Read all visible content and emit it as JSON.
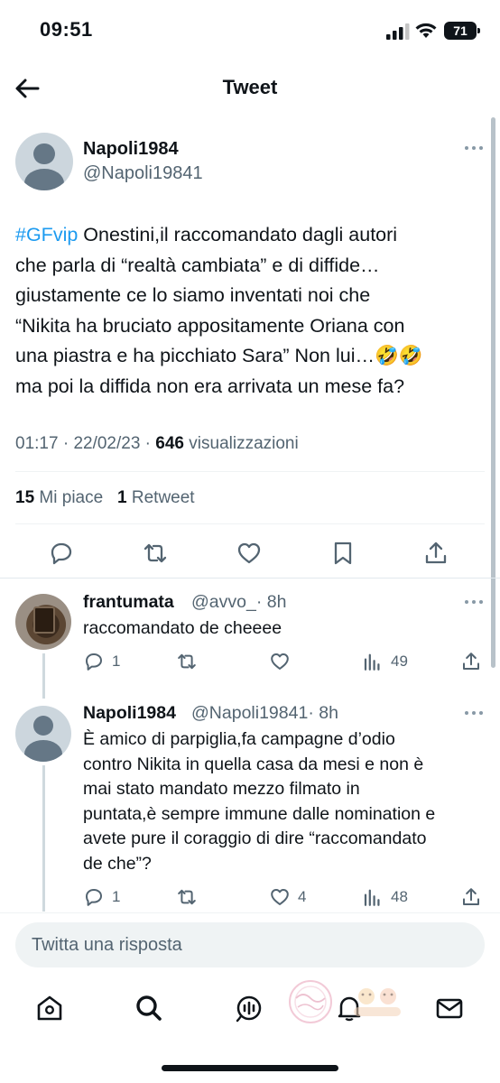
{
  "status_bar": {
    "time": "09:51",
    "battery": "71"
  },
  "header": {
    "title": "Tweet"
  },
  "tweet": {
    "author_name": "Napoli1984",
    "author_handle": "@Napoli19841",
    "hashtag": "#GFvip",
    "text_lines": [
      " Onestini,il raccomandato dagli autori",
      "che parla di “realtà cambiata” e di diffide…",
      "giustamente ce lo siamo inventati noi che",
      "“Nikita ha bruciato appositamente Oriana con",
      "una piastra e ha picchiato Sara” Non lui…🤣🤣",
      "ma poi la diffida non era arrivata un mese fa?"
    ],
    "time": "01:17",
    "date": "22/02/23",
    "views_count": "646",
    "views_label": "visualizzazioni",
    "likes_count": "15",
    "likes_label": "Mi piace",
    "retweets_count": "1",
    "retweets_label": "Retweet"
  },
  "replies": [
    {
      "name": "frantumata",
      "handle": "@avvo_",
      "time": "· 8h",
      "text": "raccomandato de cheeee",
      "reply_count": "1",
      "retweet_count": "",
      "like_count": "",
      "views": "49"
    },
    {
      "name": "Napoli1984",
      "handle": "@Napoli19841",
      "time": "· 8h",
      "text_lines": [
        "È amico di parpiglia,fa campagne d’odio",
        "contro Nikita in quella casa da mesi e non è",
        "mai stato mandato mezzo filmato in",
        "puntata,è sempre immune dalle nomination e",
        "avete pure il coraggio di dire “raccomandato",
        "de che”?"
      ],
      "reply_count": "1",
      "retweet_count": "",
      "like_count": "4",
      "views": "48"
    }
  ],
  "composer": {
    "placeholder": "Twitta una risposta"
  },
  "colors": {
    "accent": "#1d9bf0",
    "text": "#0f1419",
    "secondary": "#536471"
  },
  "icons": {
    "tabbar": [
      "home-icon",
      "search-icon",
      "spaces-icon",
      "notifications-icon",
      "messages-icon"
    ]
  }
}
